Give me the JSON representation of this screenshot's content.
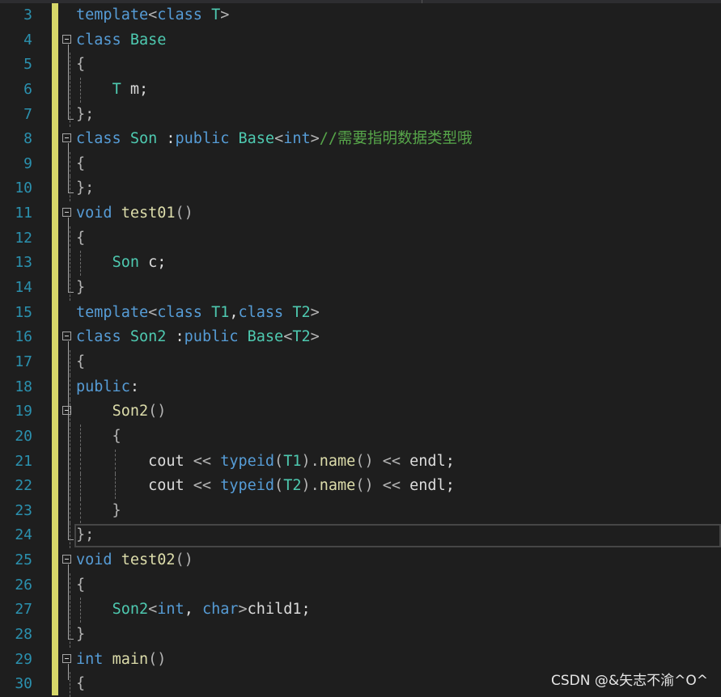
{
  "editor": {
    "line_numbers": [
      "3",
      "4",
      "5",
      "6",
      "7",
      "8",
      "9",
      "10",
      "11",
      "12",
      "13",
      "14",
      "15",
      "16",
      "17",
      "18",
      "19",
      "20",
      "21",
      "22",
      "23",
      "24",
      "25",
      "26",
      "27",
      "28",
      "29",
      "30"
    ],
    "lines": [
      [
        {
          "t": "template",
          "c": "kw"
        },
        {
          "t": "<",
          "c": "pr"
        },
        {
          "t": "class ",
          "c": "kw"
        },
        {
          "t": "T",
          "c": "ty"
        },
        {
          "t": ">",
          "c": "pr"
        }
      ],
      [
        {
          "t": "class ",
          "c": "kw"
        },
        {
          "t": "Base",
          "c": "ty"
        }
      ],
      [
        {
          "t": "{",
          "c": "pr"
        }
      ],
      [
        {
          "t": "    ",
          "c": "pl"
        },
        {
          "t": "T",
          "c": "ty"
        },
        {
          "t": " m;",
          "c": "pl"
        }
      ],
      [
        {
          "t": "};",
          "c": "pr"
        }
      ],
      [
        {
          "t": "class ",
          "c": "kw"
        },
        {
          "t": "Son",
          "c": "ty"
        },
        {
          "t": " :",
          "c": "pl"
        },
        {
          "t": "public ",
          "c": "kw"
        },
        {
          "t": "Base",
          "c": "ty"
        },
        {
          "t": "<",
          "c": "pr"
        },
        {
          "t": "int",
          "c": "kw"
        },
        {
          "t": ">",
          "c": "pr"
        },
        {
          "t": "//需要指明数据类型哦",
          "c": "cm"
        }
      ],
      [
        {
          "t": "{",
          "c": "pr"
        }
      ],
      [
        {
          "t": "};",
          "c": "pr"
        }
      ],
      [
        {
          "t": "void ",
          "c": "kw"
        },
        {
          "t": "test01",
          "c": "fn"
        },
        {
          "t": "()",
          "c": "pr"
        }
      ],
      [
        {
          "t": "{",
          "c": "pr"
        }
      ],
      [
        {
          "t": "    ",
          "c": "pl"
        },
        {
          "t": "Son",
          "c": "ty"
        },
        {
          "t": " c;",
          "c": "pl"
        }
      ],
      [
        {
          "t": "}",
          "c": "pr"
        }
      ],
      [
        {
          "t": "template",
          "c": "kw"
        },
        {
          "t": "<",
          "c": "pr"
        },
        {
          "t": "class ",
          "c": "kw"
        },
        {
          "t": "T1",
          "c": "ty"
        },
        {
          "t": ",",
          "c": "pl"
        },
        {
          "t": "class ",
          "c": "kw"
        },
        {
          "t": "T2",
          "c": "ty"
        },
        {
          "t": ">",
          "c": "pr"
        }
      ],
      [
        {
          "t": "class ",
          "c": "kw"
        },
        {
          "t": "Son2",
          "c": "ty"
        },
        {
          "t": " :",
          "c": "pl"
        },
        {
          "t": "public ",
          "c": "kw"
        },
        {
          "t": "Base",
          "c": "ty"
        },
        {
          "t": "<",
          "c": "pr"
        },
        {
          "t": "T2",
          "c": "ty"
        },
        {
          "t": ">",
          "c": "pr"
        }
      ],
      [
        {
          "t": "{",
          "c": "pr"
        }
      ],
      [
        {
          "t": "public",
          "c": "kw"
        },
        {
          "t": ":",
          "c": "pl"
        }
      ],
      [
        {
          "t": "    ",
          "c": "pl"
        },
        {
          "t": "Son2",
          "c": "fn"
        },
        {
          "t": "()",
          "c": "pr"
        }
      ],
      [
        {
          "t": "    {",
          "c": "pr"
        }
      ],
      [
        {
          "t": "        cout ",
          "c": "pl"
        },
        {
          "t": "<<",
          "c": "pr"
        },
        {
          "t": " ",
          "c": "pl"
        },
        {
          "t": "typeid",
          "c": "kw"
        },
        {
          "t": "(",
          "c": "pr"
        },
        {
          "t": "T1",
          "c": "ty"
        },
        {
          "t": ").",
          "c": "pr"
        },
        {
          "t": "name",
          "c": "fn"
        },
        {
          "t": "()",
          "c": "pr"
        },
        {
          "t": " ",
          "c": "pl"
        },
        {
          "t": "<<",
          "c": "pr"
        },
        {
          "t": " endl;",
          "c": "pl"
        }
      ],
      [
        {
          "t": "        cout ",
          "c": "pl"
        },
        {
          "t": "<<",
          "c": "pr"
        },
        {
          "t": " ",
          "c": "pl"
        },
        {
          "t": "typeid",
          "c": "kw"
        },
        {
          "t": "(",
          "c": "pr"
        },
        {
          "t": "T2",
          "c": "ty"
        },
        {
          "t": ").",
          "c": "pr"
        },
        {
          "t": "name",
          "c": "fn"
        },
        {
          "t": "()",
          "c": "pr"
        },
        {
          "t": " ",
          "c": "pl"
        },
        {
          "t": "<<",
          "c": "pr"
        },
        {
          "t": " endl;",
          "c": "pl"
        }
      ],
      [
        {
          "t": "    }",
          "c": "pr"
        }
      ],
      [
        {
          "t": "};",
          "c": "pr"
        }
      ],
      [
        {
          "t": "void ",
          "c": "kw"
        },
        {
          "t": "test02",
          "c": "fn"
        },
        {
          "t": "()",
          "c": "pr"
        }
      ],
      [
        {
          "t": "{",
          "c": "pr"
        }
      ],
      [
        {
          "t": "    ",
          "c": "pl"
        },
        {
          "t": "Son2",
          "c": "ty"
        },
        {
          "t": "<",
          "c": "pr"
        },
        {
          "t": "int",
          "c": "kw"
        },
        {
          "t": ", ",
          "c": "pl"
        },
        {
          "t": "char",
          "c": "kw"
        },
        {
          "t": ">",
          "c": "pr"
        },
        {
          "t": "child1;",
          "c": "pl"
        }
      ],
      [
        {
          "t": "}",
          "c": "pr"
        }
      ],
      [
        {
          "t": "int ",
          "c": "kw"
        },
        {
          "t": "main",
          "c": "fn"
        },
        {
          "t": "()",
          "c": "pr"
        }
      ],
      [
        {
          "t": "{",
          "c": "pr"
        }
      ]
    ]
  },
  "watermark": "CSDN @&矢志不渝^O^",
  "colors": {
    "background": "#1e1e1e",
    "line_number": "#2b91af",
    "keyword": "#569cd6",
    "type": "#4ec9b0",
    "function": "#dcdcaa",
    "comment": "#57a64a",
    "plain": "#dcdcdc",
    "change_bar": "#d6d769"
  }
}
